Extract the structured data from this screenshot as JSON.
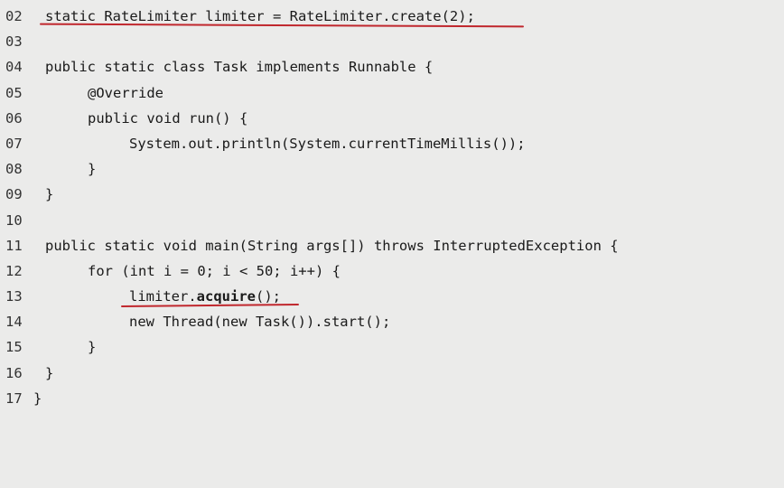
{
  "code_lines": [
    {
      "num": "02",
      "text": "static RateLimiter limiter = RateLimiter.create(2);"
    },
    {
      "num": "03",
      "text": ""
    },
    {
      "num": "04",
      "text": "public static class Task implements Runnable {"
    },
    {
      "num": "05",
      "text": "@Override"
    },
    {
      "num": "06",
      "text": "public void run() {"
    },
    {
      "num": "07",
      "text": "System.out.println(System.currentTimeMillis());"
    },
    {
      "num": "08",
      "text": "}"
    },
    {
      "num": "09",
      "text": "}"
    },
    {
      "num": "10",
      "text": ""
    },
    {
      "num": "11",
      "text": "public static void main(String args[]) throws InterruptedException {"
    },
    {
      "num": "12",
      "text": "for (int i = 0; i < 50; i++) {"
    },
    {
      "num": "13",
      "text_prefix": "limiter.",
      "text_bold": "acquire",
      "text_suffix": "();"
    },
    {
      "num": "14",
      "text": "new Thread(new Task()).start();"
    },
    {
      "num": "15",
      "text": "}"
    },
    {
      "num": "16",
      "text": "}"
    },
    {
      "num": "17",
      "text": "}"
    }
  ],
  "annotation_color": "#c0272d"
}
